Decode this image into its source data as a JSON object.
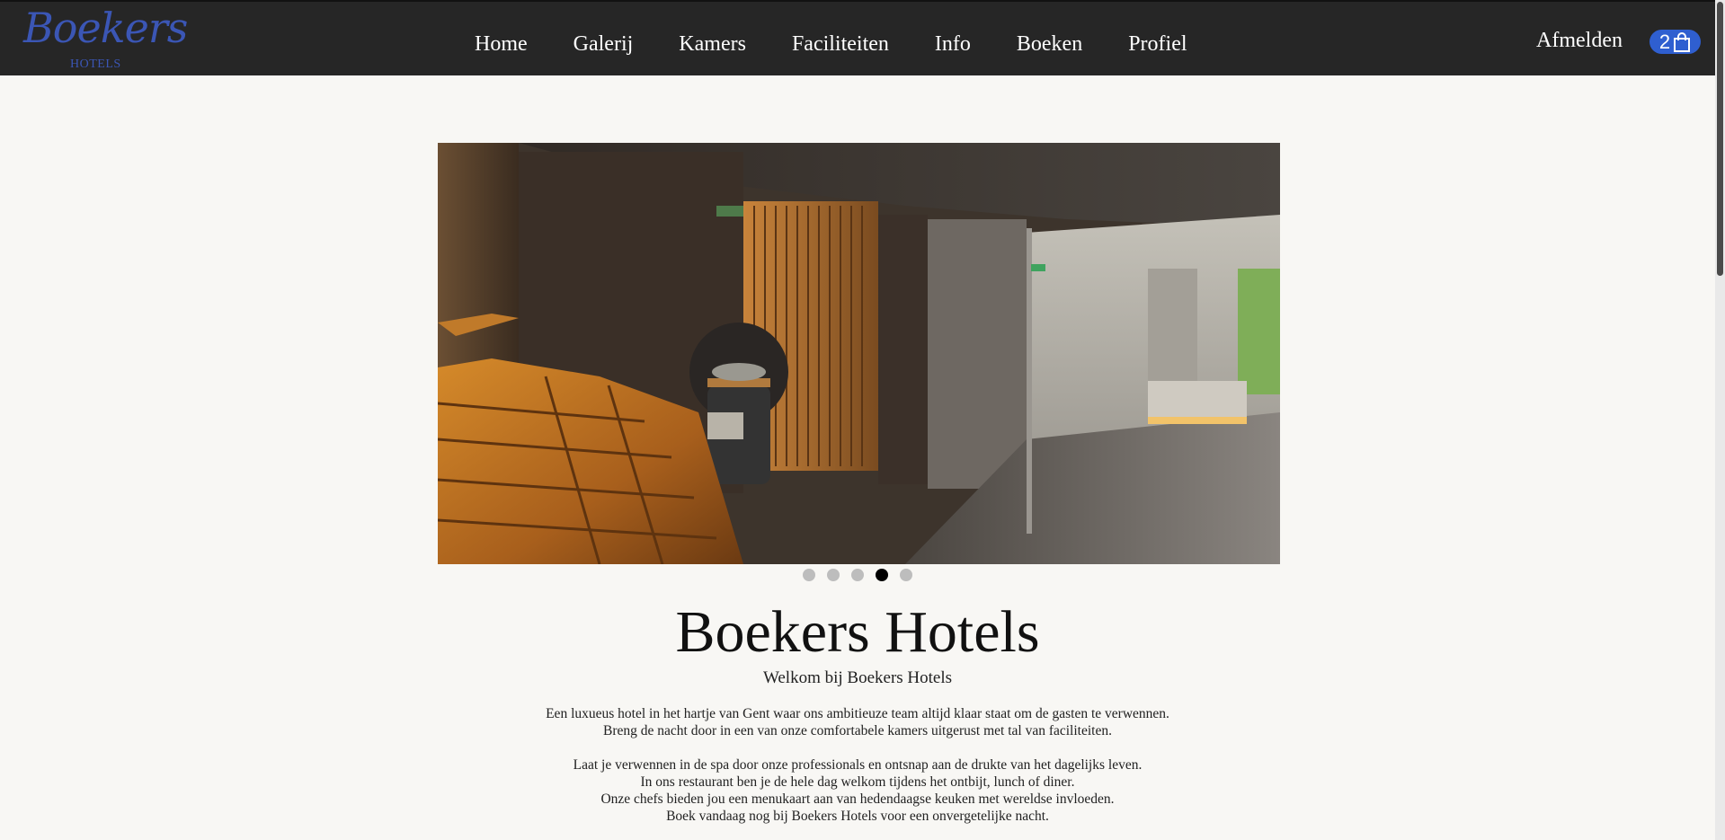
{
  "header": {
    "logo_text": "Boekers",
    "logo_sub": "HOTELS",
    "logo_color": "#3b56b5",
    "nav": [
      "Home",
      "Galerij",
      "Kamers",
      "Faciliteiten",
      "Info",
      "Boeken",
      "Profiel"
    ],
    "logout_label": "Afmelden",
    "cart_count": "2",
    "cart_icon": "shopping-bag-icon",
    "cart_color": "#2f5fd0"
  },
  "carousel": {
    "slide_count": 5,
    "active_index": 3
  },
  "main": {
    "title": "Boekers Hotels",
    "subtitle": "Welkom bij Boekers Hotels",
    "paragraph1": [
      "Een luxueus hotel in het hartje van Gent waar ons ambitieuze team altijd klaar staat om de gasten te verwennen.",
      "Breng de nacht door in een van onze comfortabele kamers uitgerust met tal van faciliteiten."
    ],
    "paragraph2": [
      "Laat je verwennen in de spa door onze professionals en ontsnap aan de drukte van het dagelijks leven.",
      "In ons restaurant ben je de hele dag welkom tijdens het ontbijt, lunch of diner.",
      "Onze chefs bieden jou een menukaart aan van hedendaagse keuken met wereldse invloeden.",
      "Boek vandaag nog bij Boekers Hotels voor een onvergetelijke nacht."
    ]
  }
}
